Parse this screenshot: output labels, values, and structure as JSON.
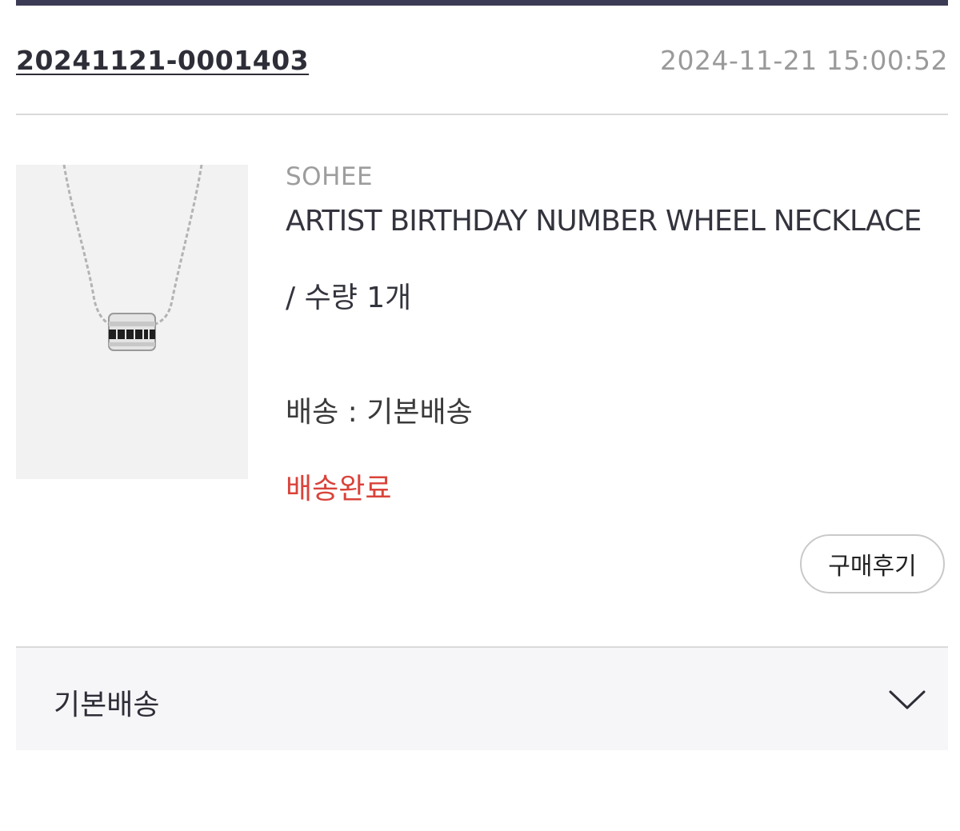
{
  "order": {
    "number": "20241121-0001403",
    "datetime": "2024-11-21 15:00:52"
  },
  "product": {
    "brand": "SOHEE",
    "name": "ARTIST BIRTHDAY NUMBER WHEEL NECKLACE",
    "quantity": "/ 수량 1개",
    "shipping": "배송 : 기본배송",
    "status": "배송완료",
    "image_icon": "necklace-product-image"
  },
  "actions": {
    "review_label": "구매후기"
  },
  "shipping_group": {
    "title": "기본배송",
    "toggle_icon": "chevron-down-icon"
  },
  "colors": {
    "top_bar": "#3b3b55",
    "status_red": "#d9433a",
    "muted_gray": "#9a9a9a",
    "accordion_bg": "#f6f6f8"
  }
}
